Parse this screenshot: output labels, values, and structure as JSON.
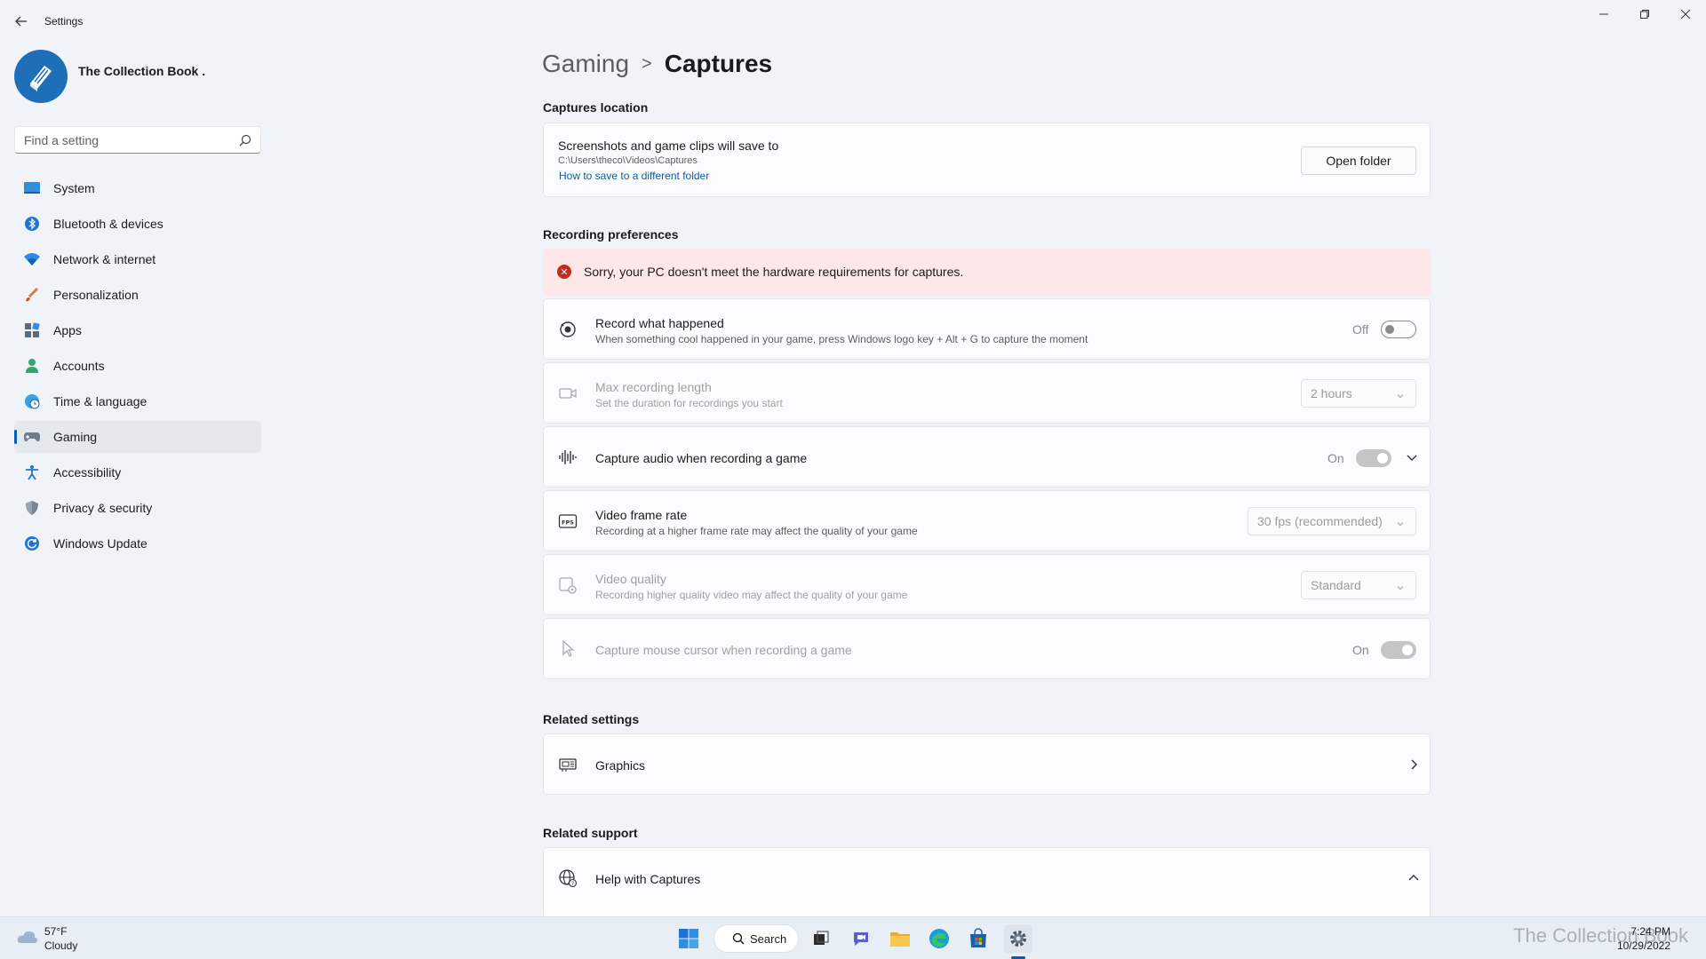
{
  "window": {
    "app_title": "Settings"
  },
  "profile": {
    "name": "The Collection Book ."
  },
  "search": {
    "placeholder": "Find a setting"
  },
  "sidebar": {
    "items": [
      {
        "label": "System",
        "icon": "monitor-icon"
      },
      {
        "label": "Bluetooth & devices",
        "icon": "bluetooth-icon"
      },
      {
        "label": "Network & internet",
        "icon": "wifi-icon"
      },
      {
        "label": "Personalization",
        "icon": "brush-icon"
      },
      {
        "label": "Apps",
        "icon": "apps-icon"
      },
      {
        "label": "Accounts",
        "icon": "person-icon"
      },
      {
        "label": "Time & language",
        "icon": "globe-clock-icon"
      },
      {
        "label": "Gaming",
        "icon": "gamepad-icon",
        "active": true
      },
      {
        "label": "Accessibility",
        "icon": "accessibility-icon"
      },
      {
        "label": "Privacy & security",
        "icon": "shield-icon"
      },
      {
        "label": "Windows Update",
        "icon": "refresh-icon"
      }
    ]
  },
  "breadcrumb": {
    "parent": "Gaming",
    "separator": ">",
    "current": "Captures"
  },
  "captures_location": {
    "heading": "Captures location",
    "title": "Screenshots and game clips will save to",
    "path": "C:\\Users\\theco\\Videos\\Captures",
    "link": "How to save to a different folder",
    "button": "Open folder"
  },
  "recording_preferences": {
    "heading": "Recording preferences",
    "error": "Sorry, your PC doesn't meet the hardware requirements for captures.",
    "record_what_happened": {
      "title": "Record what happened",
      "desc": "When something cool happened in your game, press Windows logo key + Alt + G to capture the moment",
      "state": "Off"
    },
    "max_recording_length": {
      "title": "Max recording length",
      "desc": "Set the duration for recordings you start",
      "value": "2 hours"
    },
    "capture_audio": {
      "title": "Capture audio when recording a game",
      "state": "On"
    },
    "video_frame_rate": {
      "title": "Video frame rate",
      "desc": "Recording at a higher frame rate may affect the quality of your game",
      "value": "30 fps (recommended)"
    },
    "video_quality": {
      "title": "Video quality",
      "desc": "Recording higher quality video may affect the quality of your game",
      "value": "Standard"
    },
    "capture_mouse_cursor": {
      "title": "Capture mouse cursor when recording a game",
      "state": "On"
    }
  },
  "related_settings": {
    "heading": "Related settings",
    "graphics": "Graphics"
  },
  "related_support": {
    "heading": "Related support",
    "help": "Help with Captures"
  },
  "taskbar": {
    "weather_temp": "57°F",
    "weather_cond": "Cloudy",
    "search_label": "Search",
    "time": "7:24 PM",
    "date": "10/29/2022",
    "watermark": "The Collection Book"
  },
  "colors": {
    "accent": "#005fb8",
    "error_bg": "#fde7e9",
    "error_icon": "#c42b1c",
    "background": "#f0f4f9"
  }
}
